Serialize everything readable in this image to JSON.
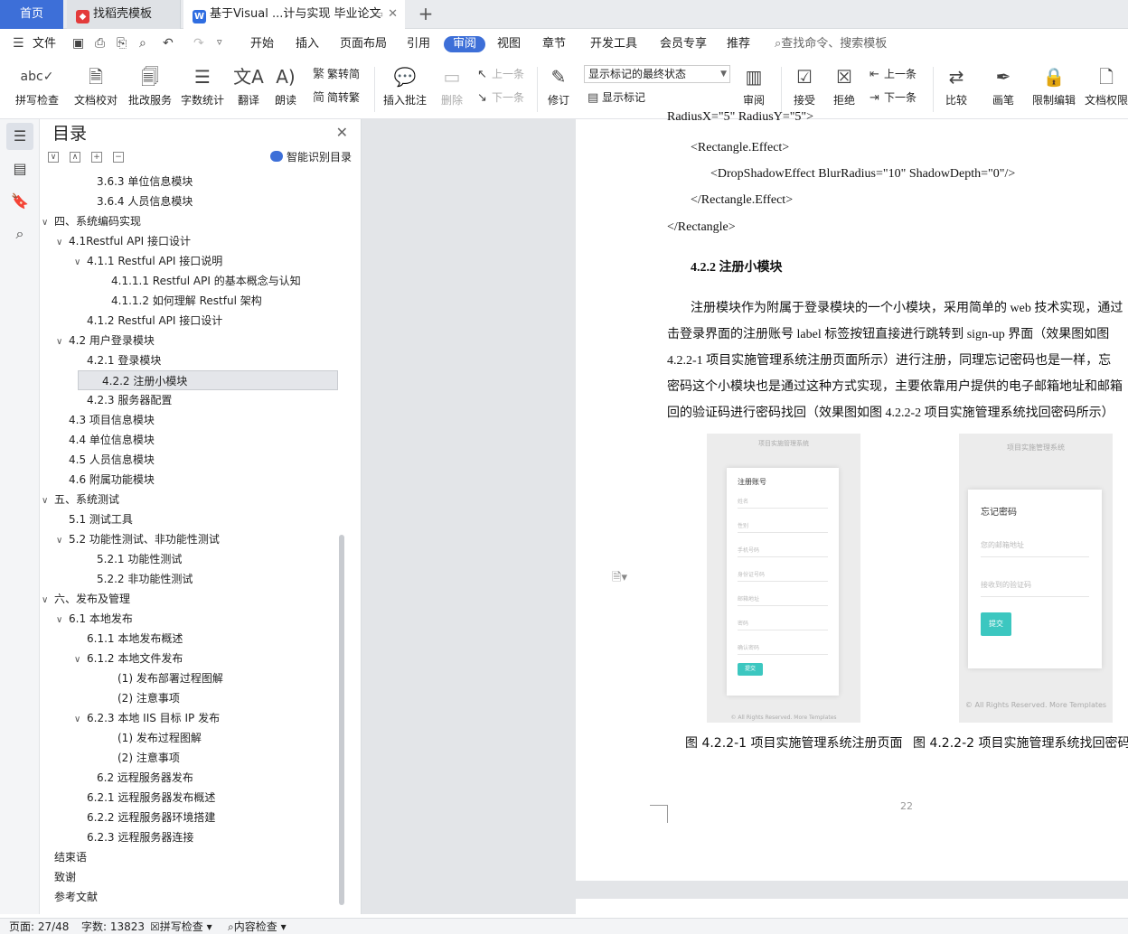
{
  "tabs": {
    "home": "首页",
    "template": "找稻壳模板",
    "document": "基于Visual ...计与实现 毕业论文",
    "add": "+"
  },
  "menu": {
    "file": "文件",
    "items": [
      "开始",
      "插入",
      "页面布局",
      "引用",
      "审阅",
      "视图",
      "章节",
      "开发工具",
      "会员专享",
      "推荐"
    ],
    "search": "查找命令、搜索模板"
  },
  "ribbon": {
    "spellcheck": "拼写检查",
    "proofread": "文档校对",
    "batch_revise": "批改服务",
    "word_count": "字数统计",
    "translate": "翻译",
    "read_aloud": "朗读",
    "trad_to_simp": "繁转简",
    "simp_to_trad": "简转繁",
    "insert_comment": "插入批注",
    "delete": "删除",
    "prev_comment": "上一条",
    "next_comment": "下一条",
    "revise": "修订",
    "markup_state": "显示标记的最终状态",
    "show_markup": "显示标记",
    "review": "审阅",
    "accept": "接受",
    "reject": "拒绝",
    "prev_change": "上一条",
    "next_change": "下一条",
    "compare": "比较",
    "pen": "画笔",
    "restrict_edit": "限制编辑",
    "doc_permission": "文档权限"
  },
  "toc": {
    "title": "目录",
    "smart": "智能识别目录",
    "items": [
      {
        "text": "3.6.3  单位信息模块",
        "level": 3,
        "tw": ""
      },
      {
        "text": "3.6.4  人员信息模块",
        "level": 3,
        "tw": ""
      },
      {
        "text": "四、系统编码实现",
        "level": 0,
        "tw": "∨"
      },
      {
        "text": "4.1Restful API 接口设计",
        "level": 1,
        "tw": "∨"
      },
      {
        "text": "4.1.1 Restful API 接口说明",
        "level": 2,
        "tw": "∨"
      },
      {
        "text": "4.1.1.1 Restful API 的基本概念与认知",
        "level": 4,
        "tw": ""
      },
      {
        "text": "4.1.1.2  如何理解 Restful 架构",
        "level": 4,
        "tw": ""
      },
      {
        "text": "4.1.2 Restful API 接口设计",
        "level": 2,
        "tw": ""
      },
      {
        "text": "4.2 用户登录模块",
        "level": 1,
        "tw": "∨"
      },
      {
        "text": "4.2.1 登录模块",
        "level": 2,
        "tw": ""
      },
      {
        "text": "4.2.2 注册小模块",
        "level": 2,
        "tw": "",
        "selected": true
      },
      {
        "text": "4.2.3 服务器配置",
        "level": 2,
        "tw": ""
      },
      {
        "text": "4.3 项目信息模块",
        "level": 1,
        "tw": ""
      },
      {
        "text": "4.4 单位信息模块",
        "level": 1,
        "tw": ""
      },
      {
        "text": "4.5 人员信息模块",
        "level": 1,
        "tw": ""
      },
      {
        "text": "4.6 附属功能模块",
        "level": 1,
        "tw": ""
      },
      {
        "text": "五、系统测试",
        "level": 0,
        "tw": "∨"
      },
      {
        "text": "5.1 测试工具",
        "level": 1,
        "tw": ""
      },
      {
        "text": "5.2 功能性测试、非功能性测试",
        "level": 1,
        "tw": "∨"
      },
      {
        "text": "5.2.1  功能性测试",
        "level": 3,
        "tw": ""
      },
      {
        "text": "5.2.2  非功能性测试",
        "level": 3,
        "tw": ""
      },
      {
        "text": "六、发布及管理",
        "level": 0,
        "tw": "∨"
      },
      {
        "text": "6.1 本地发布",
        "level": 1,
        "tw": "∨"
      },
      {
        "text": "6.1.1  本地发布概述",
        "level": 2,
        "tw": ""
      },
      {
        "text": "6.1.2  本地文件发布",
        "level": 2,
        "tw": "∨"
      },
      {
        "text": "(1)  发布部署过程图解",
        "level": 5,
        "tw": ""
      },
      {
        "text": "(2)  注意事项",
        "level": 5,
        "tw": ""
      },
      {
        "text": "6.2.3  本地 IIS 目标 IP 发布",
        "level": 2,
        "tw": "∨"
      },
      {
        "text": "(1)  发布过程图解",
        "level": 5,
        "tw": ""
      },
      {
        "text": "(2)  注意事项",
        "level": 5,
        "tw": ""
      },
      {
        "text": "6.2  远程服务器发布",
        "level": 3,
        "tw": ""
      },
      {
        "text": "6.2.1 远程服务器发布概述",
        "level": 2,
        "tw": ""
      },
      {
        "text": "6.2.2 远程服务器环境搭建",
        "level": 2,
        "tw": ""
      },
      {
        "text": "6.2.3 远程服务器连接",
        "level": 2,
        "tw": ""
      },
      {
        "text": "结束语",
        "level": 0,
        "tw": ""
      },
      {
        "text": "致谢",
        "level": 0,
        "tw": ""
      },
      {
        "text": "参考文献",
        "level": 0,
        "tw": ""
      }
    ]
  },
  "doc": {
    "code_line0": "RadiusX=\"5\" RadiusY=\"5\">",
    "code_line1": "<Rectangle.Effect>",
    "code_line2": "<DropShadowEffect BlurRadius=\"10\" ShadowDepth=\"0\"/>",
    "code_line3": "</Rectangle.Effect>",
    "code_line4": "</Rectangle>",
    "heading": "4.2.2 注册小模块",
    "para": [
      "注册模块作为附属于登录模块的一个小模块，采用简单的 web 技术实现，通过",
      "击登录界面的注册账号 label 标签按钮直接进行跳转到 sign-up 界面（效果图如图",
      "4.2.2-1  项目实施管理系统注册页面所示）进行注册，同理忘记密码也是一样，忘",
      "密码这个小模块也是通过这种方式实现，主要依靠用户提供的电子邮箱地址和邮箱",
      "回的验证码进行密码找回（效果图如图 4.2.2-2  项目实施管理系统找回密码所示）"
    ],
    "fig1": {
      "top": "项目实施管理系统",
      "card_title": "注册账号",
      "fields": [
        "姓名",
        "性别",
        "手机号码",
        "身份证号码",
        "邮箱地址",
        "密码",
        "确认密码"
      ],
      "button": "提交",
      "footer": "© All Rights Reserved. More Templates"
    },
    "fig2": {
      "top": "项目实施管理系统",
      "card_title": "忘记密码",
      "fields": [
        "您的邮箱地址",
        "接收到的验证码"
      ],
      "button": "提交",
      "footer": "© All Rights Reserved. More Templates"
    },
    "caption1": "图 4.2.2-1  项目实施管理系统注册页面",
    "caption2": "图 4.2.2-2  项目实施管理系统找回密码",
    "page_number": "22"
  },
  "status": {
    "page": "页面: 27/48",
    "words": "字数: 13823",
    "spell": "拼写检查",
    "content_check": "内容检查"
  }
}
